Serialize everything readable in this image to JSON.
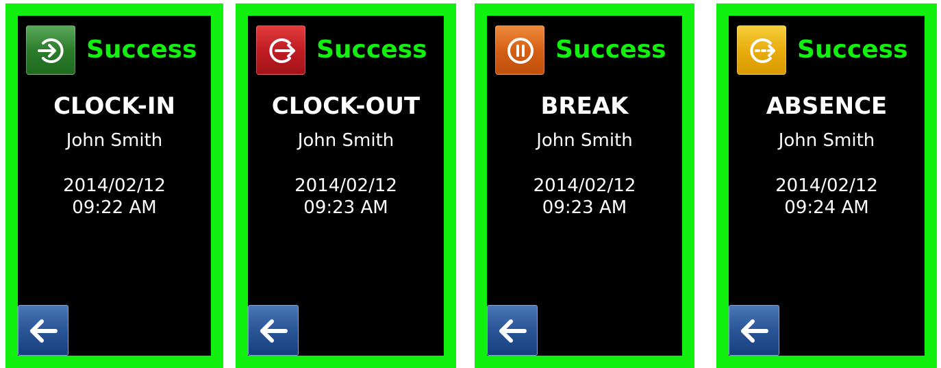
{
  "panels": [
    {
      "status": "Success",
      "action": "CLOCK-IN",
      "employee": "John Smith",
      "date": "2014/02/12",
      "time": "09:22 AM",
      "icon": "clock-in-icon",
      "icon_color": "#2c7d2c"
    },
    {
      "status": "Success",
      "action": "CLOCK-OUT",
      "employee": "John Smith",
      "date": "2014/02/12",
      "time": "09:23 AM",
      "icon": "clock-out-icon",
      "icon_color": "#c01d23"
    },
    {
      "status": "Success",
      "action": "BREAK",
      "employee": "John Smith",
      "date": "2014/02/12",
      "time": "09:23 AM",
      "icon": "break-pause-icon",
      "icon_color": "#d56016"
    },
    {
      "status": "Success",
      "action": "ABSENCE",
      "employee": "John Smith",
      "date": "2014/02/12",
      "time": "09:24 AM",
      "icon": "absence-icon",
      "icon_color": "#e9ad0e"
    }
  ],
  "colors": {
    "frame": "#11f00e",
    "status_text": "#11f00e",
    "screen_background": "#000000",
    "back_button": "#2a5596"
  },
  "back_button_icon": "back-arrow-icon"
}
